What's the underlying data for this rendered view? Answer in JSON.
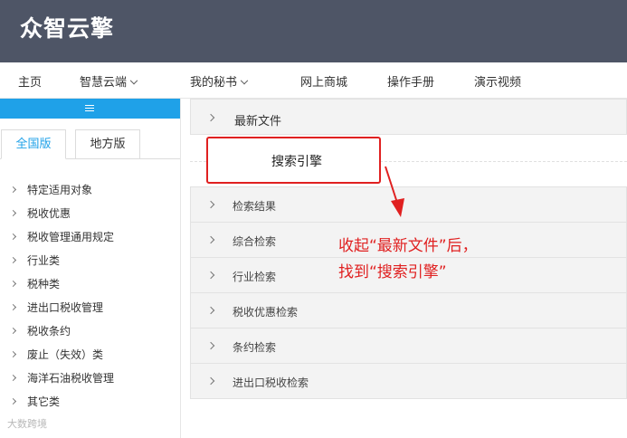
{
  "header": {
    "logo": "众智云擎"
  },
  "nav": {
    "items": [
      {
        "label": "主页"
      },
      {
        "label": "智慧云端"
      },
      {
        "label": "我的秘书"
      },
      {
        "label": "网上商城"
      },
      {
        "label": "操作手册"
      },
      {
        "label": "演示视频"
      }
    ]
  },
  "sidebar": {
    "tabs": [
      {
        "label": "全国版"
      },
      {
        "label": "地方版"
      }
    ],
    "items": [
      {
        "label": "特定适用对象"
      },
      {
        "label": "税收优惠"
      },
      {
        "label": "税收管理通用规定"
      },
      {
        "label": "行业类"
      },
      {
        "label": "税种类"
      },
      {
        "label": "进出口税收管理"
      },
      {
        "label": "税收条约"
      },
      {
        "label": "废止（失效）类"
      },
      {
        "label": "海洋石油税收管理"
      },
      {
        "label": "其它类"
      }
    ]
  },
  "watermark": "大数跨境",
  "main": {
    "latest_files": "最新文件",
    "search_engine": "搜索引擎",
    "rows": [
      {
        "label": "检索结果"
      },
      {
        "label": "综合检索"
      },
      {
        "label": "行业检索"
      },
      {
        "label": "税收优惠检索"
      },
      {
        "label": "条约检索"
      },
      {
        "label": "进出口税收检索"
      }
    ]
  },
  "annotation": {
    "line1": "收起“最新文件”后，",
    "line2": "找到“搜索引擎”"
  },
  "colors": {
    "header_bg": "#4e5566",
    "accent_blue": "#1fa1e8",
    "annotation_red": "#e02020"
  }
}
